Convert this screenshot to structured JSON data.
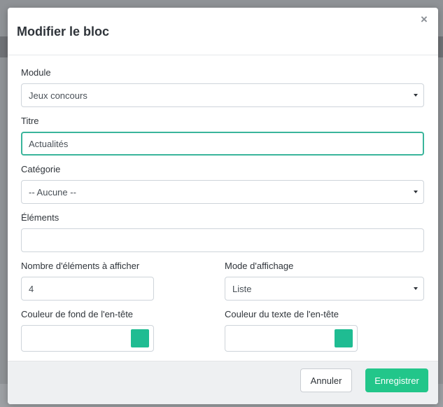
{
  "dialog": {
    "title": "Modifier le bloc",
    "close_label": "×"
  },
  "fields": {
    "module": {
      "label": "Module",
      "value": "Jeux concours"
    },
    "titre": {
      "label": "Titre",
      "value": "Actualités"
    },
    "categorie": {
      "label": "Catégorie",
      "value": "-- Aucune --"
    },
    "elements": {
      "label": "Éléments",
      "value": ""
    },
    "nombre": {
      "label": "Nombre d'éléments à afficher",
      "value": "4"
    },
    "mode": {
      "label": "Mode d'affichage",
      "value": "Liste"
    },
    "couleur_fond": {
      "label": "Couleur de fond de l'en-tête",
      "value": "",
      "color": "#1fbc92"
    },
    "couleur_texte": {
      "label": "Couleur du texte de l'en-tête",
      "value": "",
      "color": "#1fbc92"
    }
  },
  "footer": {
    "cancel_label": "Annuler",
    "save_label": "Enregistrer"
  },
  "colors": {
    "accent_focus": "#3ab59b",
    "primary_button": "#22c68a"
  }
}
